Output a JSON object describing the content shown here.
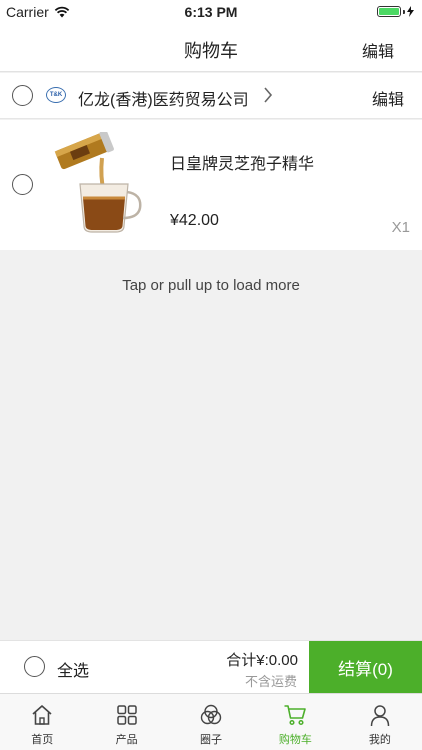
{
  "status_bar": {
    "carrier": "Carrier",
    "time": "6:13 PM",
    "battery_level": 1.0
  },
  "nav": {
    "title": "购物车",
    "edit_label": "编辑"
  },
  "store": {
    "logo_text": "T&K",
    "name": "亿龙(香港)医药贸易公司",
    "edit_label": "编辑",
    "selected": false
  },
  "product": {
    "name": "日皇牌灵芝孢子精华",
    "price": "¥42.00",
    "quantity": "X1",
    "selected": false
  },
  "load_more": "Tap or pull up to load more",
  "checkout": {
    "select_all_label": "全选",
    "total": "合计¥:0.00",
    "shipping_note": "不含运费",
    "button_label": "结算(0)"
  },
  "tabs": [
    {
      "label": "首页",
      "icon": "home-icon",
      "active": false
    },
    {
      "label": "产品",
      "icon": "grid-icon",
      "active": false
    },
    {
      "label": "圈子",
      "icon": "circles-icon",
      "active": false
    },
    {
      "label": "购物车",
      "icon": "cart-icon",
      "active": true
    },
    {
      "label": "我的",
      "icon": "person-icon",
      "active": false
    }
  ],
  "colors": {
    "accent": "#4caf2a",
    "background": "#f1f1f1",
    "battery": "#4cd964"
  }
}
